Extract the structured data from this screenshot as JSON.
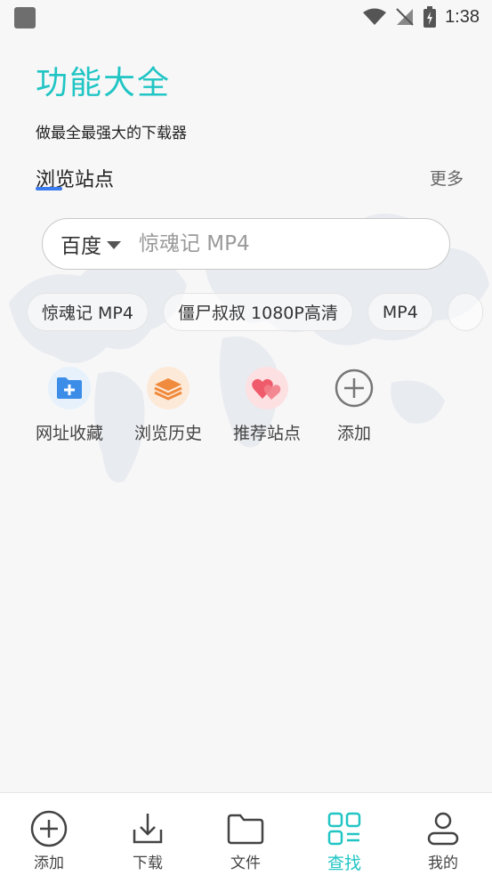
{
  "status_bar": {
    "time": "1:38"
  },
  "header": {
    "title": "功能大全",
    "subtitle": "做最全最强大的下载器"
  },
  "section": {
    "title": "浏览站点",
    "more": "更多"
  },
  "search": {
    "engine": "百度",
    "placeholder": "惊魂记 MP4"
  },
  "chips": [
    "惊魂记 MP4",
    "僵尸叔叔 1080P高清",
    "MP4"
  ],
  "quick_actions": [
    {
      "label": "网址收藏",
      "icon": "folder-add-icon"
    },
    {
      "label": "浏览历史",
      "icon": "layers-icon"
    },
    {
      "label": "推荐站点",
      "icon": "hearts-icon"
    },
    {
      "label": "添加",
      "icon": "plus-circle-icon"
    }
  ],
  "tabs": [
    {
      "label": "添加",
      "icon": "plus-circle-icon"
    },
    {
      "label": "下载",
      "icon": "download-tray-icon"
    },
    {
      "label": "文件",
      "icon": "folder-icon"
    },
    {
      "label": "查找",
      "icon": "grid-list-icon",
      "active": true
    },
    {
      "label": "我的",
      "icon": "user-icon"
    }
  ],
  "colors": {
    "accent": "#21c5c4",
    "underline": "#3a7bf0",
    "background": "#f7f7f8"
  }
}
